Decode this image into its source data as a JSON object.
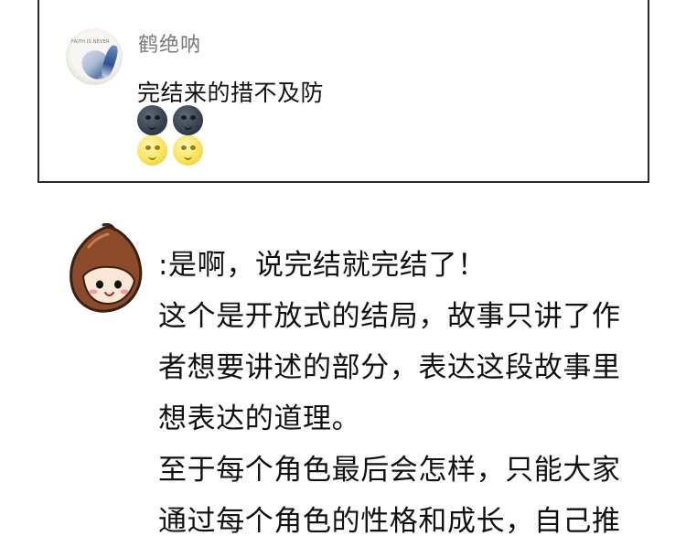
{
  "comment": {
    "username": "鹤绝呐",
    "text": "完结来的措不及防",
    "avatar_tag": "FAITH IS NEVER",
    "reactions": [
      [
        "new-moon-face-icon",
        "new-moon-face-icon"
      ],
      [
        "full-moon-face-icon",
        "full-moon-face-icon"
      ]
    ]
  },
  "reply": {
    "lines": [
      ":是啊，说完结就完结了！",
      "这个是开放式的结局，故事只讲了作",
      "者想要讲述的部分，表达这段故事里",
      "想表达的道理。",
      "至于每个角色最后会怎样，只能大家",
      "通过每个角色的性格和成长，自己推"
    ]
  },
  "colors": {
    "card_border": "#2b2b2b",
    "name": "#7a7a7a",
    "text": "#111111",
    "chestnut": "#8b4b2a"
  }
}
